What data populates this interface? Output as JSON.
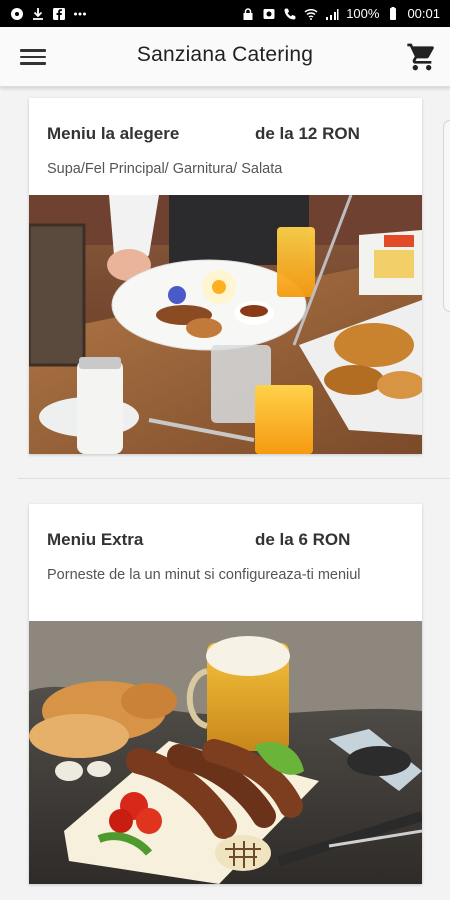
{
  "status_bar": {
    "battery": "100%",
    "time": "00:01"
  },
  "app_bar": {
    "title": "Sanziana Catering"
  },
  "cards": [
    {
      "title": "Meniu la alegere",
      "price": "de la 12 RON",
      "description": "Supa/Fel Principal/ Garnitura/ Salata",
      "image": "breakfast-plate-photo"
    },
    {
      "title": "Meniu Extra",
      "price": "de la 6 RON",
      "description": "Porneste de la un minut si configureaza-ti meniul",
      "image": "sausages-and-beer-photo"
    }
  ],
  "colors": {
    "background": "#f3f3f3",
    "app_bar": "#fafafa",
    "text_primary": "#333333"
  }
}
